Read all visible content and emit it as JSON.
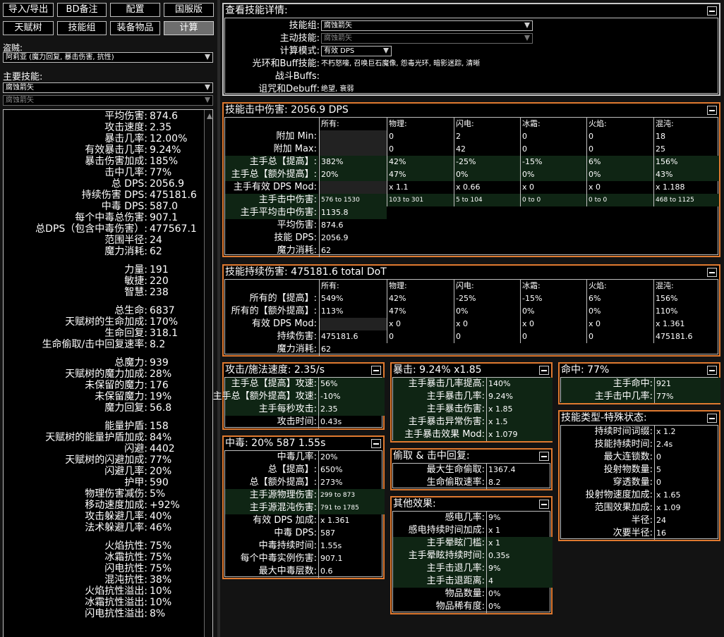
{
  "top_buttons": [
    {
      "label": "导入/导出",
      "active": false
    },
    {
      "label": "BD备注",
      "active": false
    },
    {
      "label": "配置",
      "active": false
    },
    {
      "label": "国服版",
      "active": false
    },
    {
      "label": "天赋树",
      "active": false
    },
    {
      "label": "技能组",
      "active": false
    },
    {
      "label": "装备物品",
      "active": false
    },
    {
      "label": "计算",
      "active": true
    }
  ],
  "bandit": {
    "label": "盗贼:",
    "value": "阿莉亚 (魔力回复, 暴击伤害, 抗性)"
  },
  "main_skill": {
    "label": "主要技能:",
    "value": "腐蚀箭矢",
    "sub_value": "腐蚀箭矢"
  },
  "left_stats": [
    [
      [
        "平均伤害:",
        "874.6"
      ],
      [
        "攻击速度:",
        "2.35"
      ],
      [
        "暴击几率:",
        "12.00%"
      ],
      [
        "有效暴击几率:",
        "9.24%"
      ],
      [
        "暴击伤害加成:",
        "185%"
      ],
      [
        "击中几率:",
        "77%"
      ],
      [
        "总 DPS:",
        "2056.9"
      ],
      [
        "持续伤害 DPS:",
        "475181.6"
      ],
      [
        "中毒 DPS:",
        "587.0"
      ],
      [
        "每个中毒总伤害:",
        "907.1"
      ],
      [
        "总DPS（包含中毒伤害）:",
        "477567.1"
      ],
      [
        "范围半径:",
        "24"
      ],
      [
        "魔力消耗:",
        "62"
      ]
    ],
    [
      [
        "力量:",
        "191"
      ],
      [
        "敏捷:",
        "220"
      ],
      [
        "智慧:",
        "238"
      ]
    ],
    [
      [
        "总生命:",
        "6837"
      ],
      [
        "天赋树的生命加成:",
        "170%"
      ],
      [
        "生命回复:",
        "318.1"
      ],
      [
        "生命偷取/击中回复速率:",
        "8.2"
      ]
    ],
    [
      [
        "总魔力:",
        "939"
      ],
      [
        "天赋树的魔力加成:",
        "28%"
      ],
      [
        "未保留的魔力:",
        "176"
      ],
      [
        "未保留魔力:",
        "19%"
      ],
      [
        "魔力回复:",
        "56.8"
      ]
    ],
    [
      [
        "能量护盾:",
        "158"
      ],
      [
        "天赋树的能量护盾加成:",
        "84%"
      ],
      [
        "闪避:",
        "4402"
      ],
      [
        "天赋树的闪避加成:",
        "77%"
      ],
      [
        "闪避几率:",
        "20%"
      ],
      [
        "护甲:",
        "590"
      ],
      [
        "物理伤害减伤:",
        "5%"
      ],
      [
        "移动速度加成:",
        "+92%"
      ],
      [
        "攻击躲避几率:",
        "40%"
      ],
      [
        "法术躲避几率:",
        "46%"
      ]
    ],
    [
      [
        "火焰抗性:",
        "75%"
      ],
      [
        "冰霜抗性:",
        "75%"
      ],
      [
        "闪电抗性:",
        "75%"
      ],
      [
        "混沌抗性:",
        "38%"
      ],
      [
        "火焰抗性溢出:",
        "10%"
      ],
      [
        "冰霜抗性溢出:",
        "10%"
      ],
      [
        "闪电抗性溢出:",
        "8%"
      ]
    ]
  ],
  "skill_detail": {
    "title": "查看技能详情:",
    "rows": [
      {
        "k": "技能组:",
        "v": "腐蚀箭矢",
        "type": "dd"
      },
      {
        "k": "主动技能:",
        "v": "腐蚀箭矢",
        "type": "dd-dis"
      },
      {
        "k": "计算模式:",
        "v": "有效 DPS",
        "type": "dd-short"
      },
      {
        "k": "光环和Buff技能:",
        "v": "不朽怒嚎, 召唤巨石魔像, 怨毒光环, 暗影迷踪, 清晰",
        "type": "text"
      },
      {
        "k": "战斗Buffs:",
        "v": "",
        "type": "text"
      },
      {
        "k": "诅咒和Debuff:",
        "v": "绝望, 衰弱",
        "type": "text"
      }
    ]
  },
  "hit_damage": {
    "title": "技能击中伤害: 2056.9 DPS",
    "headers": [
      "所有:",
      "物理:",
      "闪电:",
      "冰霜:",
      "火焰:",
      "混沌:"
    ],
    "rows": [
      {
        "k": "附加 Min:",
        "cells": [
          "",
          "0",
          "2",
          "0",
          "0",
          "18"
        ],
        "green": false
      },
      {
        "k": "附加 Max:",
        "cells": [
          "",
          "0",
          "42",
          "0",
          "0",
          "25"
        ],
        "green": false
      },
      {
        "k": "主手总【提高】:",
        "cells": [
          "382%",
          "42%",
          "-25%",
          "-15%",
          "6%",
          "156%"
        ],
        "green": true
      },
      {
        "k": "主手总【额外提高】:",
        "cells": [
          "20%",
          "47%",
          "0%",
          "0%",
          "0%",
          "43%"
        ],
        "green": true
      },
      {
        "k": "主手有效 DPS Mod:",
        "cells": [
          "",
          "x 1.1",
          "x 0.66",
          "x 0",
          "x 0",
          "x 1.188"
        ],
        "green": false
      },
      {
        "k": "主手击中伤害:",
        "cells": [
          "576 to 1530",
          "103 to 301",
          "5 to 104",
          "0 to 0",
          "0 to 0",
          "468 to 1125"
        ],
        "green": true,
        "small": true
      },
      {
        "k": "主手平均击中伤害:",
        "cells": [
          "1135.8"
        ],
        "green": true
      },
      {
        "k": "平均伤害:",
        "cells": [
          "874.6"
        ],
        "green": false
      },
      {
        "k": "技能 DPS:",
        "cells": [
          "2056.9"
        ],
        "green": false
      },
      {
        "k": "魔力消耗:",
        "cells": [
          "62"
        ],
        "green": false
      }
    ]
  },
  "dot_damage": {
    "title": "技能持续伤害: 475181.6 total DoT",
    "headers": [
      "所有:",
      "物理:",
      "闪电:",
      "冰霜:",
      "火焰:",
      "混沌:"
    ],
    "rows": [
      {
        "k": "所有的【提高】:",
        "cells": [
          "549%",
          "42%",
          "-25%",
          "-15%",
          "6%",
          "156%"
        ],
        "green": false
      },
      {
        "k": "所有的【额外提高】:",
        "cells": [
          "113%",
          "47%",
          "0%",
          "0%",
          "0%",
          "110%"
        ],
        "green": false
      },
      {
        "k": "有效 DPS Mod:",
        "cells": [
          "",
          "x 0",
          "x 0",
          "x 0",
          "x 0",
          "x 1.361"
        ],
        "green": false
      },
      {
        "k": "持续伤害:",
        "cells": [
          "475181.6",
          "0",
          "0",
          "0",
          "0",
          "475181.6"
        ],
        "green": false
      },
      {
        "k": "魔力消耗:",
        "cells": [
          "62"
        ],
        "green": false
      }
    ]
  },
  "attack_speed": {
    "title": "攻击/施法速度: 2.35/s",
    "rows": [
      {
        "k": "主手总【提高】攻速:",
        "v": "56%",
        "green": true
      },
      {
        "k": "主手总【额外提高】攻速:",
        "v": "-10%",
        "green": true
      },
      {
        "k": "主手每秒攻击:",
        "v": "2.35",
        "green": true
      },
      {
        "k": "攻击时间:",
        "v": "0.43s",
        "green": false
      }
    ]
  },
  "crit": {
    "title": "暴击: 9.24% x1.85",
    "rows": [
      {
        "k": "主手暴击几率提高:",
        "v": "140%",
        "green": true
      },
      {
        "k": "主手暴击几率:",
        "v": "9.24%",
        "green": true
      },
      {
        "k": "主手暴击伤害:",
        "v": "x 1.85",
        "green": true
      },
      {
        "k": "主手暴击异常伤害:",
        "v": "x 1.5",
        "green": true
      },
      {
        "k": "主手暴击效果 Mod:",
        "v": "x 1.079",
        "green": true
      }
    ]
  },
  "hit": {
    "title": "命中: 77%",
    "rows": [
      {
        "k": "主手命中:",
        "v": "921",
        "green": true
      },
      {
        "k": "主手击中几率:",
        "v": "77%",
        "green": true
      }
    ]
  },
  "poison": {
    "title": "中毒: 20% 587 1.55s",
    "rows": [
      {
        "k": "中毒几率:",
        "v": "20%",
        "green": false
      },
      {
        "k": "总【提高】:",
        "v": "650%",
        "green": false
      },
      {
        "k": "总【额外提高】:",
        "v": "273%",
        "green": false
      },
      {
        "k": "主手源物理伤害:",
        "v": "299 to 873",
        "green": true,
        "small": true
      },
      {
        "k": "主手源混沌伤害:",
        "v": "791 to 1785",
        "green": true,
        "small": true
      },
      {
        "k": "有效 DPS 加成:",
        "v": "x 1.361",
        "green": false
      },
      {
        "k": "中毒 DPS:",
        "v": "587",
        "green": false
      },
      {
        "k": "中毒持续时间:",
        "v": "1.55s",
        "green": false
      },
      {
        "k": "每个中毒实例伤害:",
        "v": "907.1",
        "green": false
      },
      {
        "k": "最大中毒层数:",
        "v": "0.6",
        "green": false
      }
    ]
  },
  "leech": {
    "title": "偷取 & 击中回复:",
    "rows": [
      {
        "k": "最大生命偷取:",
        "v": "1367.4",
        "green": false
      },
      {
        "k": "生命偷取速率:",
        "v": "8.2",
        "green": false
      }
    ]
  },
  "other": {
    "title": "其他效果:",
    "rows": [
      {
        "k": "感电几率:",
        "v": "9%",
        "green": false
      },
      {
        "k": "感电持续时间加成:",
        "v": "x 1",
        "green": false
      },
      {
        "k": "主手晕眩门槛:",
        "v": "x 1",
        "green": true
      },
      {
        "k": "主手晕眩持续时间:",
        "v": "0.35s",
        "green": true
      },
      {
        "k": "主手击退几率:",
        "v": "9%",
        "green": true
      },
      {
        "k": "主手击退距离:",
        "v": "4",
        "green": true
      },
      {
        "k": "物品数量:",
        "v": "0%",
        "green": false
      },
      {
        "k": "物品稀有度:",
        "v": "0%",
        "green": false
      }
    ]
  },
  "skill_type": {
    "title": "技能类型-特殊状态:",
    "rows": [
      {
        "k": "持续时间词缀:",
        "v": "x 1.2",
        "green": false
      },
      {
        "k": "技能持续时间:",
        "v": "2.4s",
        "green": false
      },
      {
        "k": "最大连锁数:",
        "v": "0",
        "green": false
      },
      {
        "k": "投射物数量:",
        "v": "5",
        "green": false
      },
      {
        "k": "穿透数量:",
        "v": "0",
        "green": false
      },
      {
        "k": "投射物速度加成:",
        "v": "x 1.65",
        "green": false
      },
      {
        "k": "范围效果加成:",
        "v": "x 1.09",
        "green": false
      },
      {
        "k": "半径:",
        "v": "24",
        "green": false
      },
      {
        "k": "次要半径:",
        "v": "16",
        "green": false
      }
    ]
  }
}
